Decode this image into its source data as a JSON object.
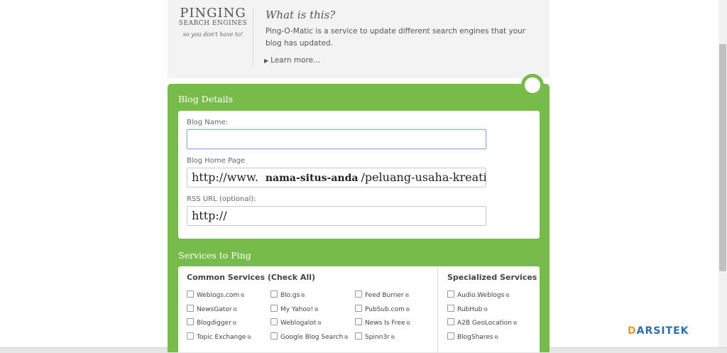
{
  "header": {
    "logo": {
      "line1": "PINGING",
      "line2": "SEARCH ENGINES",
      "line3": "so you don't have to!"
    },
    "what_title": "What is this?",
    "what_desc": "Ping-O-Matic is a service to update different search engines that your blog has updated.",
    "learn_more": "Learn more..."
  },
  "blog_details": {
    "title": "Blog Details",
    "blog_name_label": "Blog Name:",
    "blog_name_value": "",
    "home_page_label": "Blog Home Page",
    "home_page_prefix": "http://www.",
    "home_page_bold": "nama-situs-anda",
    "home_page_suffix": "/peluang-usaha-kreatif-u",
    "rss_label": "RSS URL (optional):",
    "rss_value": "http://"
  },
  "services": {
    "title": "Services to Ping",
    "common_head": "Common Services (Check All)",
    "special_head": "Specialized Services",
    "common": [
      [
        "Weblogs.com",
        "NewsGator",
        "Blogdigger",
        "Topic Exchange"
      ],
      [
        "Blo.gs",
        "My Yahoo!",
        "Weblogalot",
        "Google Blog Search"
      ],
      [
        "Feed Burner",
        "PubSub.com",
        "News Is Free",
        "Spinn3r"
      ]
    ],
    "special": [
      "Audio.Weblogs",
      "RubHub",
      "A2B GeoLocation",
      "BlogShares"
    ]
  },
  "watermark": {
    "d": "D",
    "rest": "ARSITEK"
  },
  "colors": {
    "green": "#77bb4a",
    "header_bg": "#f3f3f3"
  }
}
